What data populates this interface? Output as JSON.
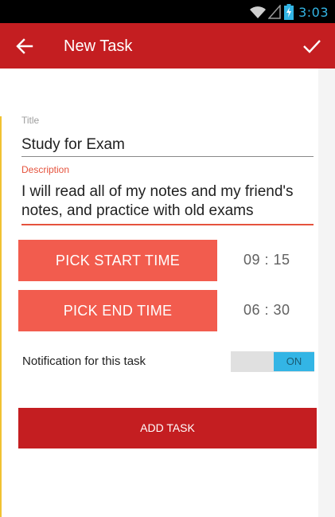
{
  "status_bar": {
    "time": "3:03",
    "icons": [
      "wifi-icon",
      "signal-icon",
      "battery-charging-icon"
    ],
    "clock_color": "#33b5e5"
  },
  "app_bar": {
    "title": "New Task",
    "back_icon": "arrow-left-icon",
    "confirm_icon": "check-icon",
    "background_color": "#c41e21"
  },
  "form": {
    "title_label": "Title",
    "title_value": "Study for Exam",
    "description_label": "Description",
    "description_value": "I will read all of my notes and my friend's notes, and practice with old exams",
    "pick_start_label": "PICK START TIME",
    "start_time": "09 : 15",
    "pick_end_label": "PICK END TIME",
    "end_time": "06 : 30",
    "notification_label": "Notification for this task",
    "notification_toggle": "ON",
    "add_task_label": "ADD TASK"
  },
  "colors": {
    "accent": "#f25c4e",
    "primary_dark": "#c41e21",
    "toggle_on": "#33b5e5",
    "focused_underline": "#e5533d"
  }
}
